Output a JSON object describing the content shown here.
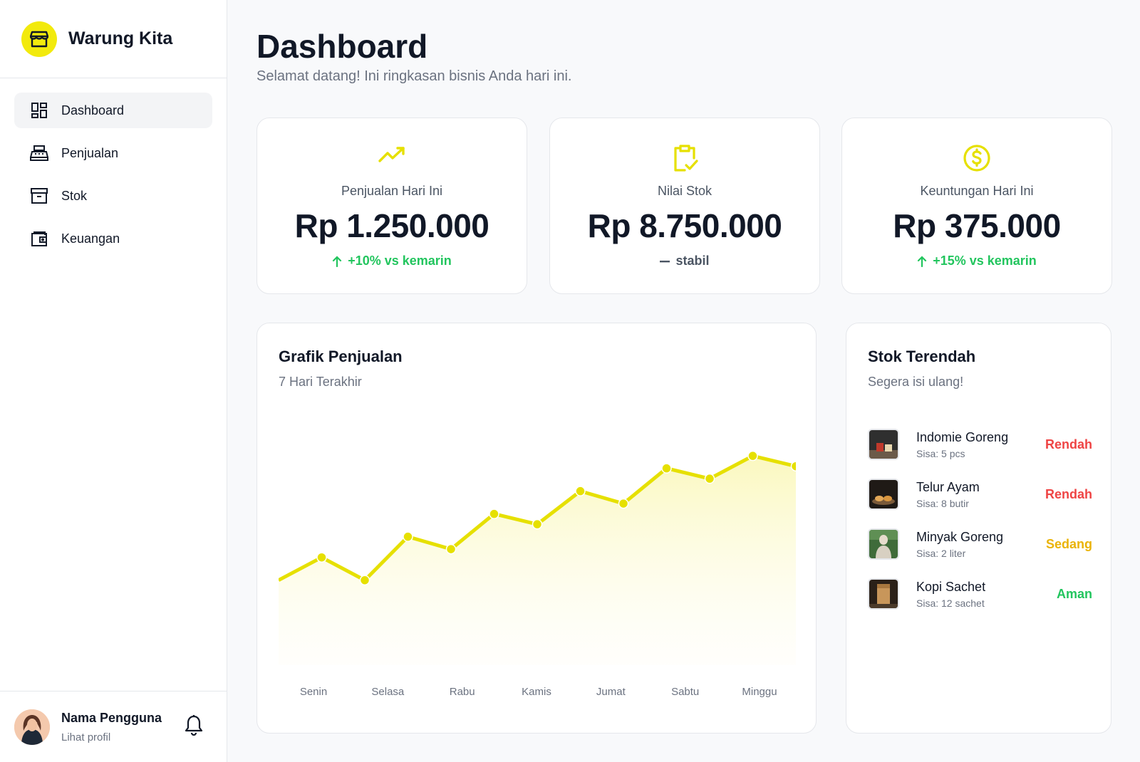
{
  "brand": {
    "name": "Warung Kita",
    "icon": "store-icon",
    "accent": "#f2ea0d"
  },
  "sidebar": {
    "items": [
      {
        "label": "Dashboard",
        "icon": "dashboard-icon",
        "active": true
      },
      {
        "label": "Penjualan",
        "icon": "cash-register-icon",
        "active": false
      },
      {
        "label": "Stok",
        "icon": "archive-box-icon",
        "active": false
      },
      {
        "label": "Keuangan",
        "icon": "wallet-icon",
        "active": false
      }
    ]
  },
  "profile": {
    "name": "Nama Pengguna",
    "link": "Lihat profil",
    "icon": "bell-icon"
  },
  "header": {
    "title": "Dashboard",
    "subtitle": "Selamat datang! Ini ringkasan bisnis Anda hari ini."
  },
  "stats": [
    {
      "label": "Penjualan Hari Ini",
      "value": "Rp 1.250.000",
      "delta": "+10% vs kemarin",
      "trend": "up",
      "icon": "trending-up-icon"
    },
    {
      "label": "Nilai Stok",
      "value": "Rp 8.750.000",
      "delta": "stabil",
      "trend": "flat",
      "icon": "clipboard-check-icon"
    },
    {
      "label": "Keuntungan Hari Ini",
      "value": "Rp 375.000",
      "delta": "+15% vs kemarin",
      "trend": "up",
      "icon": "dollar-circle-icon"
    }
  ],
  "chart": {
    "title": "Grafik Penjualan",
    "subtitle": "7 Hari Terakhir"
  },
  "chart_data": {
    "type": "area",
    "title": "Grafik Penjualan",
    "subtitle": "7 Hari Terakhir",
    "categories": [
      "Senin",
      "Selasa",
      "Rabu",
      "Kamis",
      "Jumat",
      "Sabtu",
      "Minggu"
    ],
    "values": [
      41,
      52,
      41,
      62,
      56,
      73,
      68,
      84,
      78,
      95,
      90,
      101,
      96
    ],
    "ylim": [
      0,
      110
    ],
    "grid": false,
    "color": "#e6e000"
  },
  "stock": {
    "title": "Stok Terendah",
    "subtitle": "Segera isi ulang!",
    "items": [
      {
        "name": "Indomie Goreng",
        "qty": "Sisa: 5 pcs",
        "status": "Rendah",
        "color": "#ef4444"
      },
      {
        "name": "Telur Ayam",
        "qty": "Sisa: 8 butir",
        "status": "Rendah",
        "color": "#ef4444"
      },
      {
        "name": "Minyak Goreng",
        "qty": "Sisa: 2 liter",
        "status": "Sedang",
        "color": "#eab308"
      },
      {
        "name": "Kopi Sachet",
        "qty": "Sisa: 12 sachet",
        "status": "Aman",
        "color": "#22c55e"
      }
    ]
  }
}
